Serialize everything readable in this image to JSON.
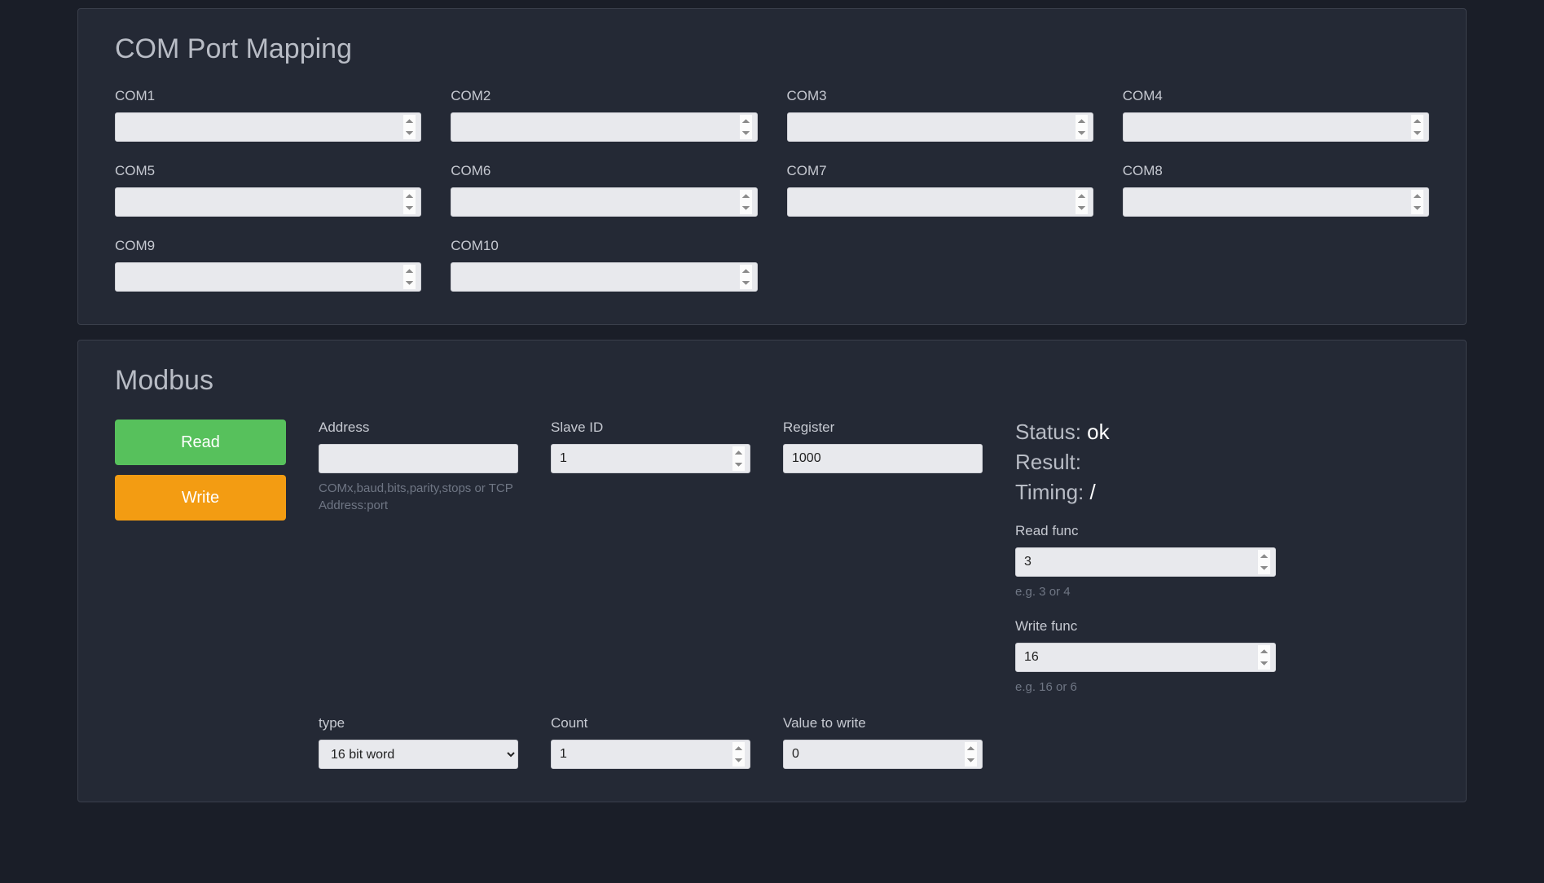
{
  "com_mapping": {
    "title": "COM Port Mapping",
    "ports": [
      {
        "label": "COM1",
        "value": ""
      },
      {
        "label": "COM2",
        "value": ""
      },
      {
        "label": "COM3",
        "value": ""
      },
      {
        "label": "COM4",
        "value": ""
      },
      {
        "label": "COM5",
        "value": ""
      },
      {
        "label": "COM6",
        "value": ""
      },
      {
        "label": "COM7",
        "value": ""
      },
      {
        "label": "COM8",
        "value": ""
      },
      {
        "label": "COM9",
        "value": ""
      },
      {
        "label": "COM10",
        "value": ""
      }
    ]
  },
  "modbus": {
    "title": "Modbus",
    "read_label": "Read",
    "write_label": "Write",
    "address_label": "Address",
    "address_value": "",
    "address_help": "COMx,baud,bits,parity,stops or TCP Address:port",
    "slave_label": "Slave ID",
    "slave_value": "1",
    "register_label": "Register",
    "register_value": "1000",
    "type_label": "type",
    "type_value": "16 bit word",
    "count_label": "Count",
    "count_value": "1",
    "value_label": "Value to write",
    "value_value": "0",
    "status_label": "Status: ",
    "status_value": "ok",
    "result_label": "Result:",
    "result_value": "",
    "timing_label": "Timing: ",
    "timing_value": "/",
    "readfunc_label": "Read func",
    "readfunc_value": "3",
    "readfunc_help": "e.g. 3 or 4",
    "writefunc_label": "Write func",
    "writefunc_value": "16",
    "writefunc_help": "e.g. 16 or 6"
  }
}
